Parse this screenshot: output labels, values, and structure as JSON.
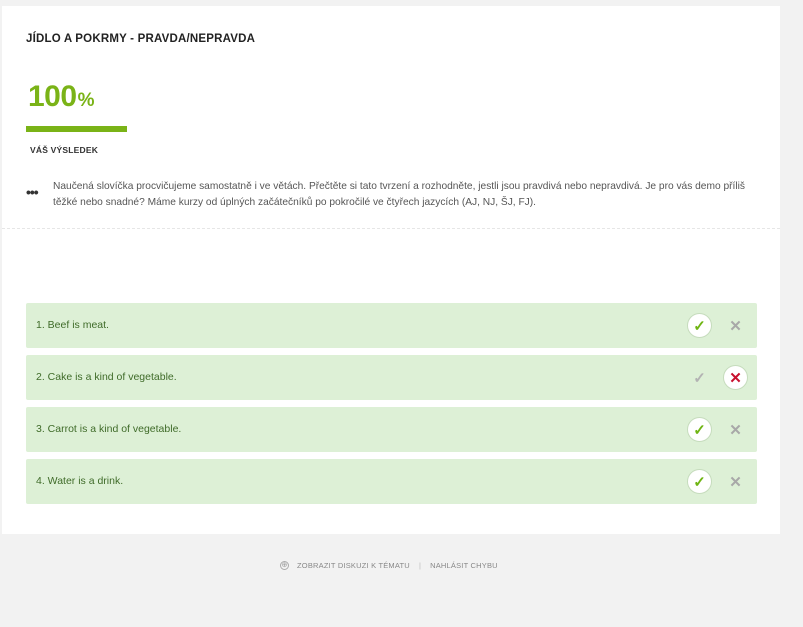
{
  "quiz": {
    "title": "JÍDLO A POKRMY - PRAVDA/NEPRAVDA",
    "score_value": "100",
    "score_unit": "%",
    "score_fraction": 1.0,
    "result_label": "VÁŠ VÝSLEDEK",
    "more_label": "•••",
    "description": "Naučená slovíčka procvičujeme samostatně i ve větách. Přečtěte si tato tvrzení a rozhodněte, jestli jsou pravdivá nebo nepravdivá. Je pro vás demo příliš těžké nebo snadné? Máme kurzy od úplných začátečníků po pokročilé ve čtyřech jazycích (AJ, NJ, ŠJ, FJ)."
  },
  "questions": [
    {
      "text": "1. Beef is meat.",
      "answer": "true"
    },
    {
      "text": "2. Cake is a kind of vegetable.",
      "answer": "false"
    },
    {
      "text": "3. Carrot is a kind of vegetable.",
      "answer": "true"
    },
    {
      "text": "4. Water is a drink.",
      "answer": "true"
    }
  ],
  "icons": {
    "true": "✓",
    "false": "✕"
  },
  "colors": {
    "accent": "#7ab317",
    "row_bg": "#ddf0d6",
    "wrong": "#c8102e"
  },
  "footer": {
    "discuss_icon": "⊕",
    "discuss_label": "ZOBRAZIT DISKUZI K TÉMATU",
    "divider": "|",
    "report_label": "NAHLÁSIT CHYBU"
  }
}
